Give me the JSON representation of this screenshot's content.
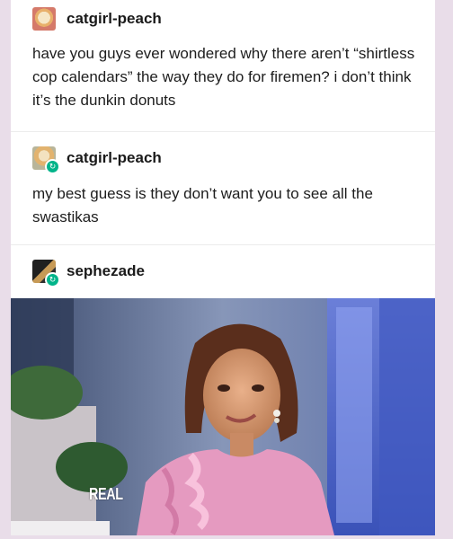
{
  "posts": [
    {
      "username": "catgirl-peach",
      "text": "have you guys ever wondered why there aren’t “shirtless cop calendars” the way they do for firemen? i don’t think it’s the dunkin donuts",
      "avatar": "anime-avatar",
      "reblog": false
    },
    {
      "username": "catgirl-peach",
      "text": "my best guess is they don’t want you to see all the swastikas",
      "avatar": "anime-avatar",
      "reblog": true
    },
    {
      "username": "sephezade",
      "avatar": "dark-avatar",
      "reblog": true
    }
  ],
  "image": {
    "watermark": "REAL",
    "description_icon": "reaction-gif"
  },
  "colors": {
    "page_bg": "#e9dde9",
    "reblog_badge": "#00b48a"
  }
}
